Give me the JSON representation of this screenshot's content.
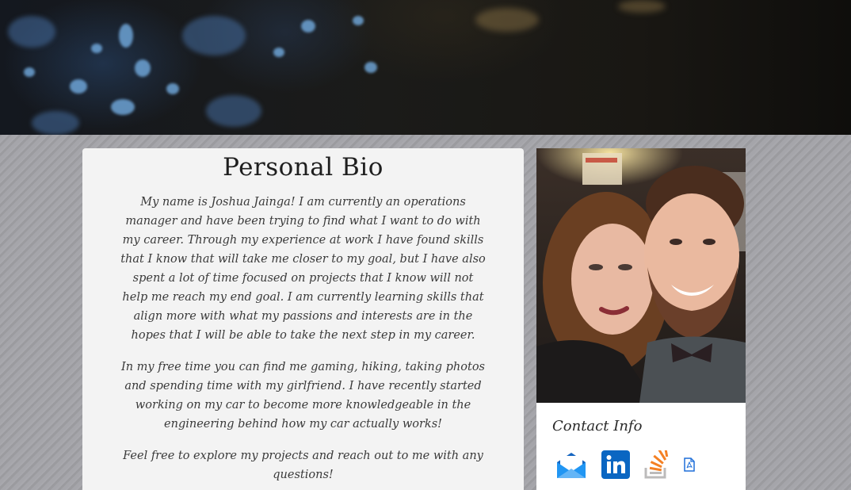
{
  "bio": {
    "title": "Personal Bio",
    "paragraphs": [
      "My name is Joshua Jainga! I am currently an operations manager and have been trying to find what I want to do with my career. Through my experience at work I have found skills that I know that will take me closer to my goal, but I have also spent a lot of time focused on projects that I know will not help me reach my end goal. I am currently learning skills that align more with what my passions and interests are in the hopes that I will be able to take the next step in my career.",
      "In my free time you can find me gaming, hiking, taking photos and spending time with my girlfriend. I have recently started working on my car to become more knowledgeable in the engineering behind how my car actually works!",
      "Feel free to explore my projects and reach out to me with any questions!"
    ]
  },
  "sidebar": {
    "photo_icon": "portrait-photo",
    "contact_heading": "Contact Info",
    "contact_links": [
      {
        "icon": "email-icon"
      },
      {
        "icon": "linkedin-icon"
      },
      {
        "icon": "stackoverflow-icon"
      },
      {
        "icon": "resume-pdf-icon"
      }
    ]
  },
  "colors": {
    "page_background": "#a3a3a8",
    "card_background": "#f3f3f3",
    "linkedin_blue": "#0a66c2",
    "email_blue": "#1e88d9",
    "stackoverflow_orange": "#f48024"
  }
}
